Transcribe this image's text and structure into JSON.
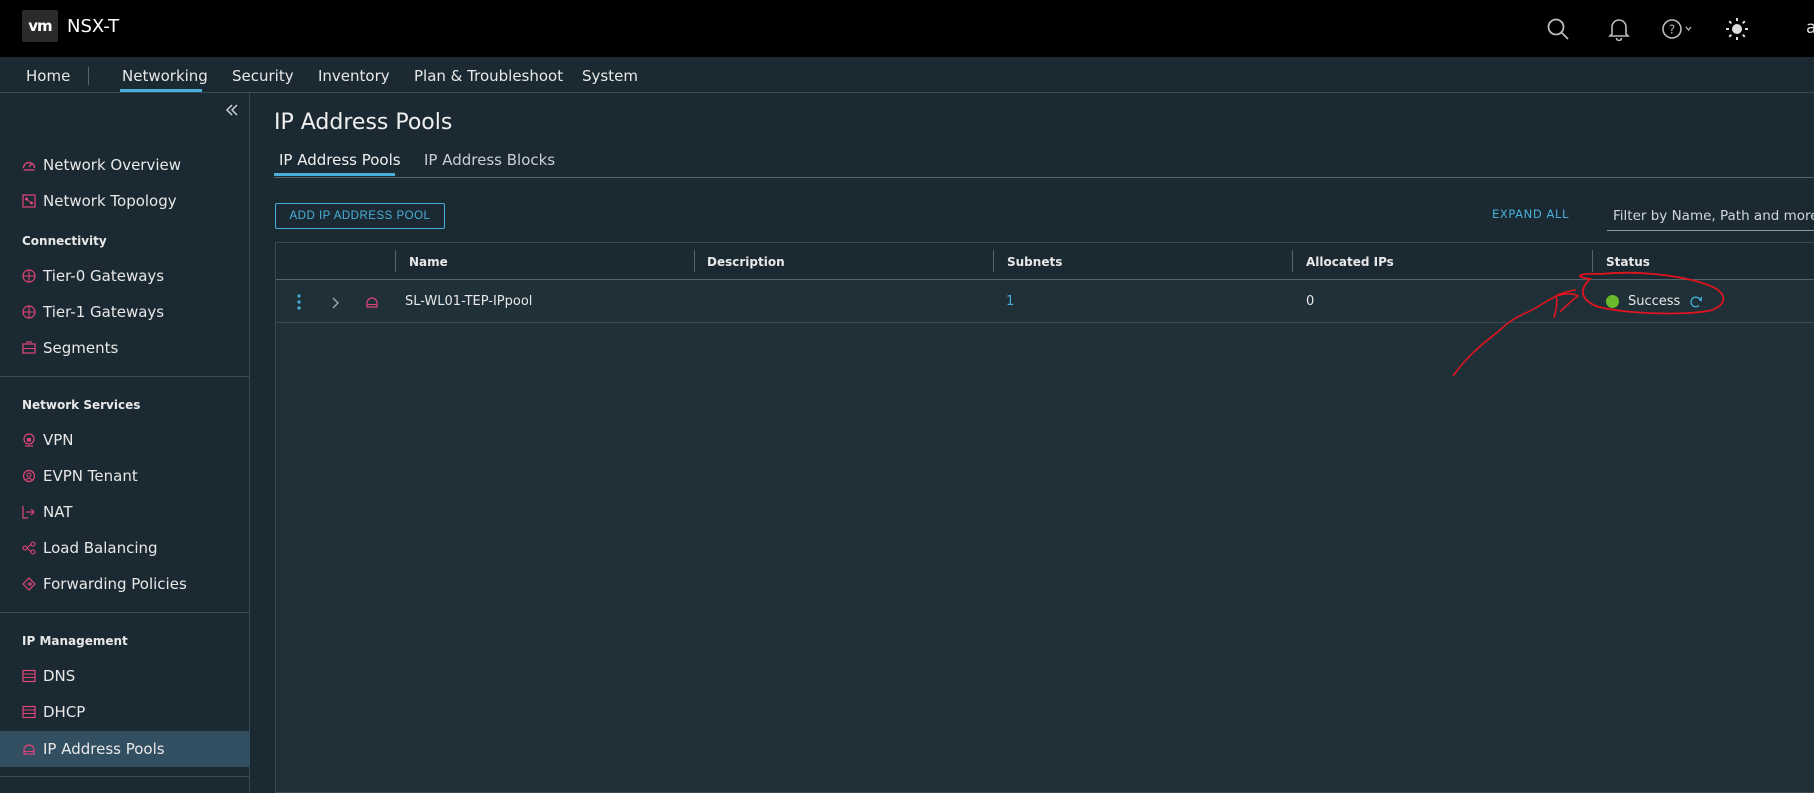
{
  "header": {
    "logo": "vm",
    "app_title": "NSX-T",
    "icons": [
      "search-icon",
      "bell-icon",
      "help-icon",
      "theme-icon"
    ],
    "user_initial": "a"
  },
  "mainnav": {
    "items": [
      "Home",
      "Networking",
      "Security",
      "Inventory",
      "Plan & Troubleshoot",
      "System"
    ],
    "active": "Networking"
  },
  "sidebar": {
    "top_items": [
      {
        "label": "Network Overview",
        "icon": "network-overview-icon"
      },
      {
        "label": "Network Topology",
        "icon": "network-topology-icon"
      }
    ],
    "connectivity": {
      "heading": "Connectivity",
      "items": [
        {
          "label": "Tier-0 Gateways",
          "icon": "gateway-icon"
        },
        {
          "label": "Tier-1 Gateways",
          "icon": "gateway-icon"
        },
        {
          "label": "Segments",
          "icon": "segments-icon"
        }
      ]
    },
    "network_services": {
      "heading": "Network Services",
      "items": [
        {
          "label": "VPN",
          "icon": "vpn-icon"
        },
        {
          "label": "EVPN Tenant",
          "icon": "evpn-icon"
        },
        {
          "label": "NAT",
          "icon": "nat-icon"
        },
        {
          "label": "Load Balancing",
          "icon": "load-balancing-icon"
        },
        {
          "label": "Forwarding Policies",
          "icon": "forwarding-icon"
        }
      ]
    },
    "ip_management": {
      "heading": "IP Management",
      "items": [
        {
          "label": "DNS",
          "icon": "dns-icon"
        },
        {
          "label": "DHCP",
          "icon": "dhcp-icon"
        },
        {
          "label": "IP Address Pools",
          "icon": "ip-pool-icon"
        }
      ]
    },
    "active": "IP Address Pools"
  },
  "main": {
    "title": "IP Address Pools",
    "tabs": [
      "IP Address Pools",
      "IP Address Blocks"
    ],
    "active_tab": "IP Address Pools",
    "add_button": "ADD IP ADDRESS POOL",
    "expand_all": "EXPAND ALL",
    "filter_placeholder": "Filter by Name, Path and more",
    "table": {
      "columns": [
        "Name",
        "Description",
        "Subnets",
        "Allocated IPs",
        "Status"
      ],
      "rows": [
        {
          "name": "SL-WL01-TEP-IPpool",
          "description": "",
          "subnets": "1",
          "allocated_ips": "0",
          "status": "Success",
          "status_color": "#6ab92a"
        }
      ]
    }
  },
  "colors": {
    "accent": "#49afd9",
    "annotation": "#e0141e"
  }
}
